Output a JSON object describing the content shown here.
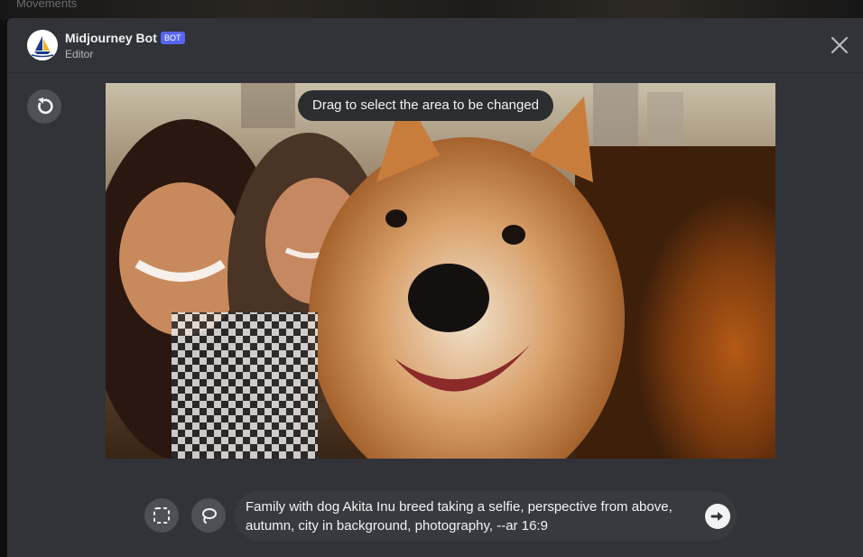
{
  "background": {
    "behind_text": "Movements"
  },
  "header": {
    "bot_name": "Midjourney Bot",
    "badge": "BOT",
    "subtitle": "Editor"
  },
  "editor": {
    "tooltip": "Drag to select the area to be changed",
    "image_description_icon": "photo-of-family-selfie-with-akita-dog"
  },
  "tools": {
    "rectangle_icon": "rectangle-select-icon",
    "lasso_icon": "lasso-select-icon",
    "undo_icon": "undo-icon",
    "close_icon": "close-icon",
    "send_icon": "send-arrow-icon"
  },
  "prompt": {
    "value": "Family with dog Akita Inu breed taking a selfie, perspective from above, autumn, city in background, photography, --ar 16:9"
  },
  "colors": {
    "modal_bg": "#313338",
    "button_bg": "#4e5058",
    "badge_bg": "#5865f2",
    "prompt_bg": "#383a40"
  }
}
